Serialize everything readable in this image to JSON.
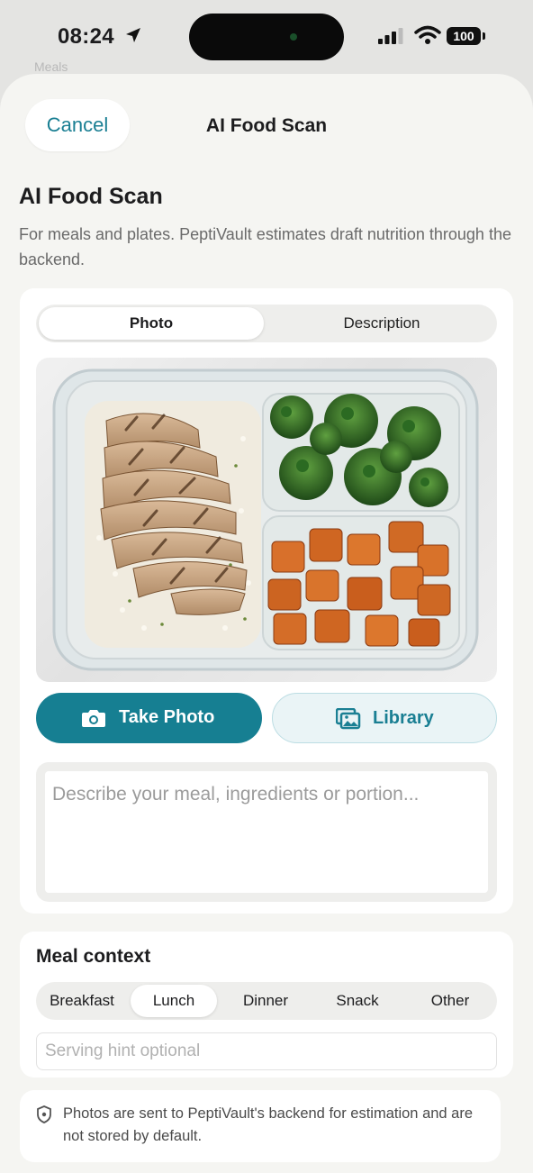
{
  "status_bar": {
    "time": "08:24",
    "battery": "100"
  },
  "background_label": "Meals",
  "nav": {
    "cancel_label": "Cancel",
    "title": "AI Food Scan"
  },
  "header": {
    "title": "AI Food Scan",
    "subtitle": "For meals and plates. PeptiVault estimates draft nutrition through the backend."
  },
  "mode_tabs": {
    "selected": "Photo",
    "items": [
      "Photo",
      "Description"
    ]
  },
  "actions": {
    "take_photo": "Take Photo",
    "library": "Library"
  },
  "description": {
    "placeholder": "Describe your meal, ingredients or portion..."
  },
  "meal_context": {
    "title": "Meal context",
    "selected": "Lunch",
    "options": [
      "Breakfast",
      "Lunch",
      "Dinner",
      "Snack",
      "Other"
    ],
    "serving_hint_placeholder": "Serving hint optional"
  },
  "privacy_note": "Photos are sent to PeptiVault's backend for estimation and are not stored by default.",
  "colors": {
    "accent": "#167f92",
    "accent_light": "#eaf4f6",
    "sheet_bg": "#f5f5f2"
  }
}
